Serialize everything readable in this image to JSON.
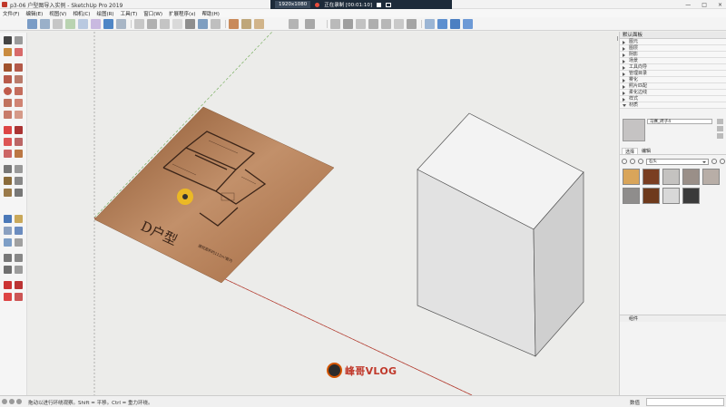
{
  "window": {
    "title": "p3-06 户型图导入实例 - SketchUp Pro 2019",
    "controls": [
      "—",
      "□",
      "×"
    ]
  },
  "recorder": {
    "resolution": "1920x1080",
    "status": "正在录制 [00:01:10]"
  },
  "menu": [
    "文件(F)",
    "编辑(E)",
    "视图(V)",
    "相机(C)",
    "绘图(R)",
    "工具(T)",
    "窗口(W)",
    "扩展程序(x)",
    "帮助(H)"
  ],
  "right_panel": {
    "tray_title": "默认面板",
    "sections": [
      {
        "label": "图元",
        "open": false
      },
      {
        "label": "图层",
        "open": false
      },
      {
        "label": "阴影",
        "open": false
      },
      {
        "label": "场景",
        "open": false
      },
      {
        "label": "工具向导",
        "open": false
      },
      {
        "label": "管理目录",
        "open": false
      },
      {
        "label": "雾化",
        "open": false
      },
      {
        "label": "照片匹配",
        "open": false
      },
      {
        "label": "柔化边线",
        "open": false
      },
      {
        "label": "样式",
        "open": false
      },
      {
        "label": "材质",
        "open": true
      }
    ],
    "material_name": "马赛_砖子4",
    "tabs": [
      "选择",
      "编辑"
    ],
    "material_category": "石头",
    "swatch_colors": [
      "#d9a55a",
      "#7a3e21",
      "#c4c2c0",
      "#9a8f88",
      "#b8aea7",
      "#8f8d8c",
      "#6e3a1c",
      "#d8d8d8",
      "#3b3b3b"
    ],
    "tray_bottom": "组件"
  },
  "status": {
    "hint": "拖动以进行环绕观察。Shift = 平移。Ctrl = 重力环绕。",
    "vcb_label": "数值"
  },
  "watermark": {
    "text": "峰哥VLOG"
  },
  "floorplan": {
    "caption": "建筑面积约112m²套内",
    "label": "D户型"
  },
  "colors": {
    "floorplan_paper": "#b9825b",
    "box_top": "#f2f2f2",
    "box_left": "#dcdcdc",
    "box_right": "#c8c8c8"
  }
}
